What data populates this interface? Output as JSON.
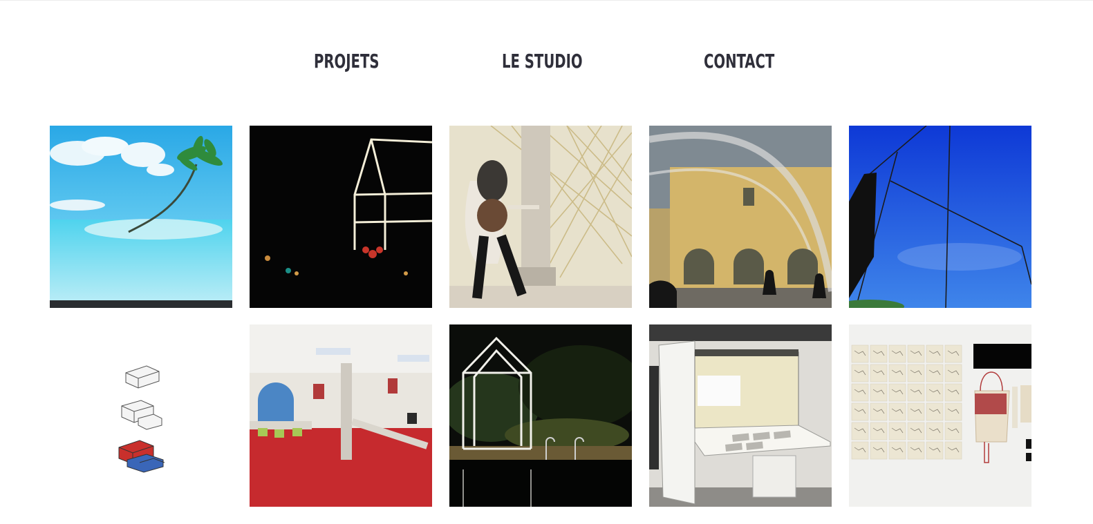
{
  "nav": {
    "projets": "PROJETS",
    "studio": "LE STUDIO",
    "contact": "CONTACT"
  },
  "colors": {
    "nav_text": "#2f2f3a",
    "background": "#ffffff"
  },
  "gallery": {
    "rows": 2,
    "columns": 5,
    "tiles": [
      "palm-island-photo",
      "light-house-frame-night-photo",
      "performer-with-bamboo-installation-photo",
      "transparent-dome-courtyard-photo",
      "sky-cables-sculpture-photo",
      "axonometric-module-drawings",
      "red-floor-workshop-room-photo",
      "house-frame-by-pool-photo",
      "white-cabinet-projection-photo",
      "sketches-wall-and-bags-photo"
    ]
  }
}
